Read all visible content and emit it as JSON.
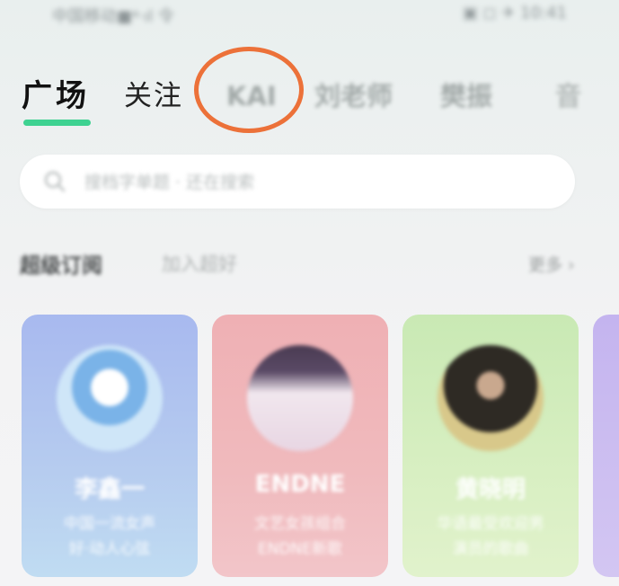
{
  "status_bar": {
    "left": "中国移动■ᵠ·ıl 令",
    "right": "▣ ◻ ✈ 10:41"
  },
  "tabs": [
    {
      "label": "广场",
      "active": true
    },
    {
      "label": "关注",
      "active": false
    },
    {
      "label": "KAI",
      "active": false
    },
    {
      "label": "刘老师",
      "active": false
    },
    {
      "label": "樊振",
      "active": false
    },
    {
      "label": "音",
      "active": false
    }
  ],
  "accent_color": "#3ed291",
  "annotation_color": "#ec7139",
  "search": {
    "placeholder": "搜档字单题 · 还在搜索"
  },
  "section": {
    "title": "超级订阅",
    "subtitle": "加入超好",
    "more": "更多 ›"
  },
  "cards": [
    {
      "name": "李鑫一",
      "desc1": "中国一流女声",
      "desc2": "好·动人心弦",
      "bg": "#a8b9ef"
    },
    {
      "name": "ENDNE",
      "desc1": "文艺女孩组合",
      "desc2": "ENDNE新歌",
      "bg": "#efb0b4"
    },
    {
      "name": "黄晓明",
      "desc1": "华语最受欢迎男",
      "desc2": "演员的歌曲",
      "bg": "#c9e9b4"
    },
    {
      "bg": "#c4b4ef"
    }
  ]
}
